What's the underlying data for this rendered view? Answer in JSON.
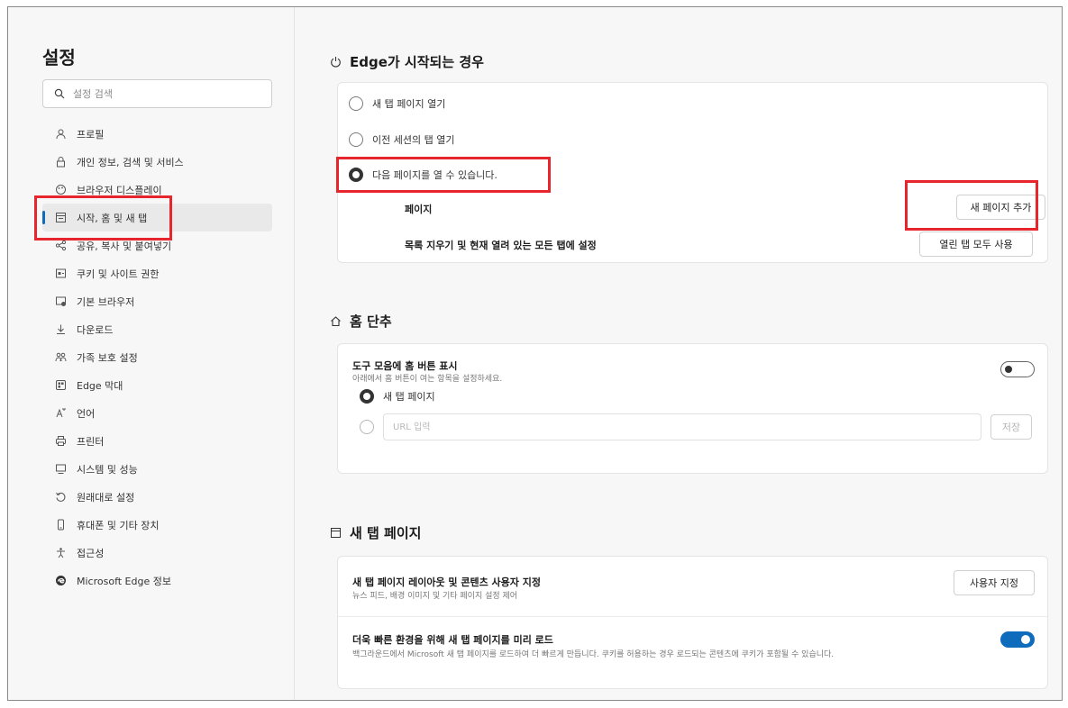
{
  "sidebar": {
    "title": "설정",
    "search_placeholder": "설정 검색",
    "items": [
      {
        "label": "프로필",
        "icon": "profile-icon"
      },
      {
        "label": "개인 정보, 검색 및 서비스",
        "icon": "lock-icon"
      },
      {
        "label": "브라우저 디스플레이",
        "icon": "appearance-icon"
      },
      {
        "label": "시작, 홈 및 새 탭",
        "icon": "new-tab-icon",
        "active": true
      },
      {
        "label": "공유, 복사 및 붙여넣기",
        "icon": "share-icon"
      },
      {
        "label": "쿠키 및 사이트 권한",
        "icon": "site-permissions-icon"
      },
      {
        "label": "기본 브라우저",
        "icon": "default-browser-icon"
      },
      {
        "label": "다운로드",
        "icon": "download-icon"
      },
      {
        "label": "가족 보호 설정",
        "icon": "family-icon"
      },
      {
        "label": "Edge 막대",
        "icon": "edge-bar-icon"
      },
      {
        "label": "언어",
        "icon": "language-icon"
      },
      {
        "label": "프린터",
        "icon": "printer-icon"
      },
      {
        "label": "시스템 및 성능",
        "icon": "system-icon"
      },
      {
        "label": "원래대로 설정",
        "icon": "reset-icon"
      },
      {
        "label": "휴대폰 및 기타 장치",
        "icon": "phone-icon"
      },
      {
        "label": "접근성",
        "icon": "accessibility-icon"
      },
      {
        "label": "Microsoft Edge 정보",
        "icon": "edge-logo-icon"
      }
    ]
  },
  "startup": {
    "title": "Edge가 시작되는 경우",
    "icon": "power-icon",
    "options": [
      "새 탭 페이지 열기",
      "이전 세션의 탭 열기",
      "다음 페이지를 열 수 있습니다."
    ],
    "selected_index": 2,
    "pages_label": "페이지",
    "add_page_button": "새 페이지 추가",
    "clear_label": "목록 지우기 및 현재 열려 있는 모든 탭에 설정",
    "use_all_tabs_button": "열린 탭 모두 사용"
  },
  "home": {
    "title": "홈 단추",
    "icon": "home-icon",
    "show_home_title": "도구 모음에 홈 버튼 표시",
    "show_home_desc": "아래에서 홈 버튼이 여는 항목을 설정하세요.",
    "show_home_toggle": false,
    "option_new_tab": "새 탭 페이지",
    "url_placeholder": "URL 입력",
    "save_button": "저장"
  },
  "new_tab": {
    "title": "새 탭 페이지",
    "icon": "new-tab-page-icon",
    "customize_title": "새 탭 페이지 레이아웃 및 콘텐츠 사용자 지정",
    "customize_desc": "뉴스 피드, 배경 이미지 및 기타 페이지 설정 제어",
    "customize_button": "사용자 지정",
    "preload_title": "더욱 빠른 환경을 위해 새 탭 페이지를 미리 로드",
    "preload_desc": "백그라운드에서 Microsoft 새 탭 페이지를 로드하여 더 빠르게 만듭니다. 쿠키를 허용하는 경우 로드되는 콘텐츠에 쿠키가 포함될 수 있습니다.",
    "preload_toggle": true
  },
  "colors": {
    "accent": "#0f6cbd",
    "highlight": "#e6262c"
  }
}
